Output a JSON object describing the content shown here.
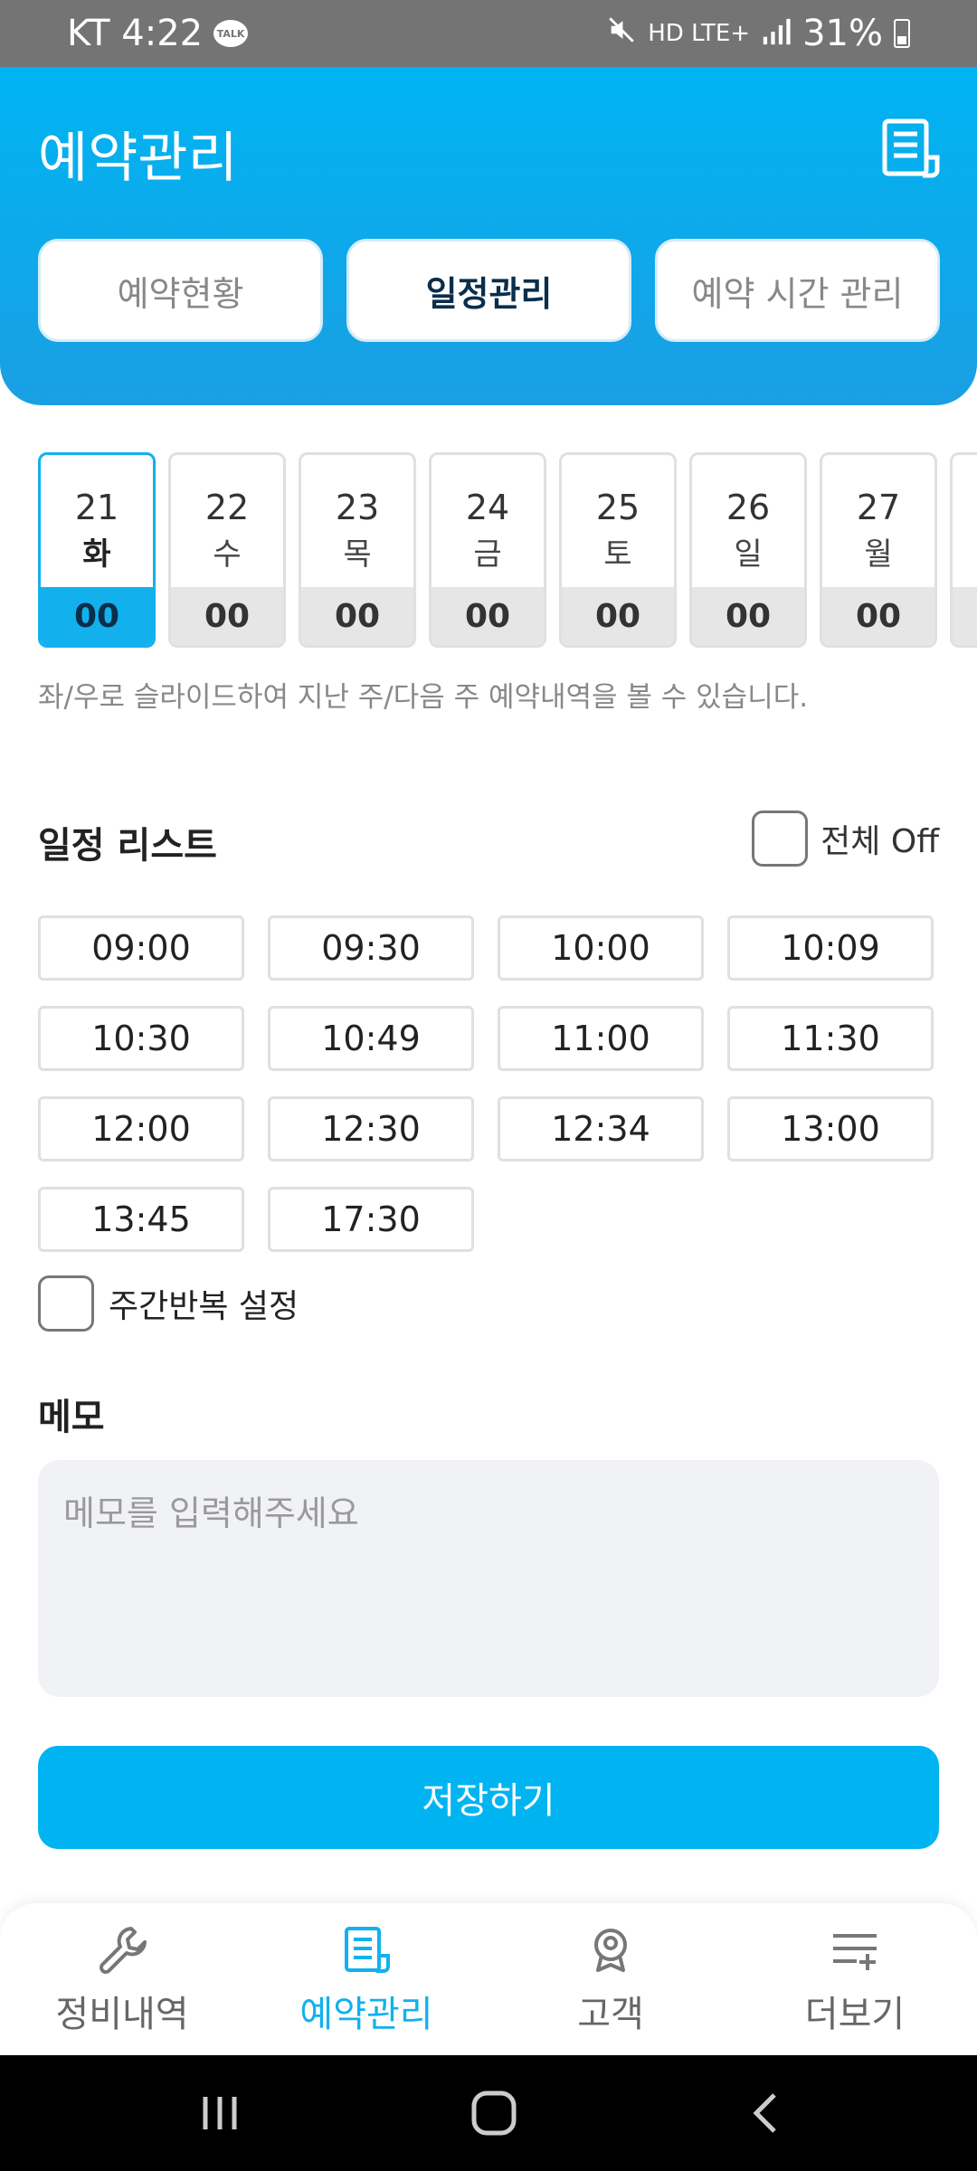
{
  "status_bar": {
    "carrier_time": "KT 4:22",
    "talk_icon": "TALK",
    "network": "HD LTE+",
    "battery": "31%"
  },
  "header": {
    "title": "예약관리",
    "tabs": [
      {
        "label": "예약현황",
        "active": false
      },
      {
        "label": "일정관리",
        "active": true
      },
      {
        "label": "예약 시간 관리",
        "active": false
      }
    ]
  },
  "days": [
    {
      "num": "21",
      "dow": "화",
      "count": "00",
      "selected": true
    },
    {
      "num": "22",
      "dow": "수",
      "count": "00",
      "selected": false
    },
    {
      "num": "23",
      "dow": "목",
      "count": "00",
      "selected": false
    },
    {
      "num": "24",
      "dow": "금",
      "count": "00",
      "selected": false
    },
    {
      "num": "25",
      "dow": "토",
      "count": "00",
      "selected": false
    },
    {
      "num": "26",
      "dow": "일",
      "count": "00",
      "selected": false
    },
    {
      "num": "27",
      "dow": "월",
      "count": "00",
      "selected": false
    }
  ],
  "hint": "좌/우로 슬라이드하여 지난 주/다음 주 예약내역을 볼 수 있습니다.",
  "schedule": {
    "title": "일정 리스트",
    "all_off_label": "전체 Off",
    "slots": [
      "09:00",
      "09:30",
      "10:00",
      "10:09",
      "10:30",
      "10:49",
      "11:00",
      "11:30",
      "12:00",
      "12:30",
      "12:34",
      "13:00",
      "13:45",
      "17:30"
    ],
    "repeat_label": "주간반복 설정"
  },
  "memo": {
    "title": "메모",
    "placeholder": "메모를 입력해주세요"
  },
  "save_label": "저장하기",
  "bottom_nav": [
    {
      "label": "정비내역",
      "icon": "wrench-icon",
      "active": false
    },
    {
      "label": "예약관리",
      "icon": "document-icon",
      "active": true
    },
    {
      "label": "고객",
      "icon": "customer-icon",
      "active": false
    },
    {
      "label": "더보기",
      "icon": "more-list-icon",
      "active": false
    }
  ],
  "colors": {
    "accent": "#00b4f2",
    "dark_text": "#0b2e4a"
  }
}
